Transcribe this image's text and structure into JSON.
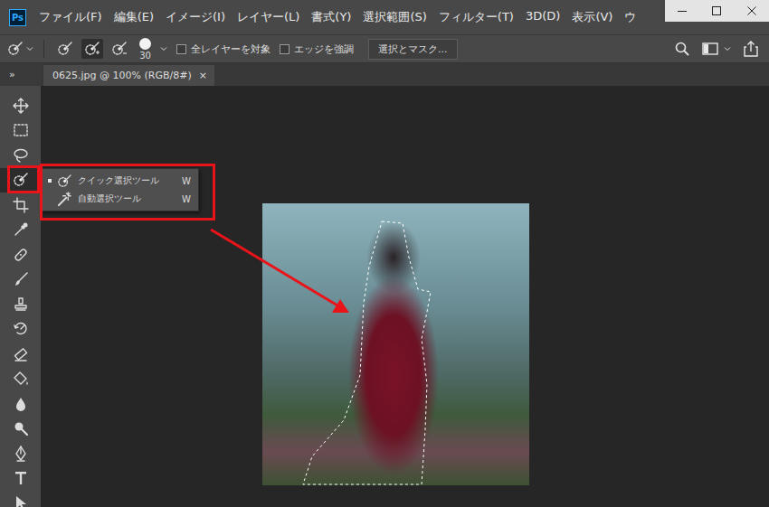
{
  "app": {
    "logo": "Ps"
  },
  "menu_bar": [
    "ファイル(F)",
    "編集(E)",
    "イメージ(I)",
    "レイヤー(L)",
    "書式(Y)",
    "選択範囲(S)",
    "フィルター(T)",
    "3D(D)",
    "表示(V)",
    "ウ"
  ],
  "options_bar": {
    "selection_modes": [
      {
        "selected": false
      },
      {
        "selected": true
      },
      {
        "selected": false
      }
    ],
    "brush_size": "30",
    "checkboxes": [
      {
        "label": "全レイヤーを対象",
        "checked": false
      },
      {
        "label": "エッジを強調",
        "checked": false
      }
    ],
    "button": "選択とマスク..."
  },
  "panel_toggle": "»",
  "document_tabs": [
    {
      "label": "0625.jpg @ 100% (RGB/8#)",
      "close": "×",
      "selected": true
    }
  ],
  "tools": [
    {
      "kind": "move",
      "selected": false
    },
    {
      "kind": "marquee",
      "selected": false
    },
    {
      "kind": "lasso",
      "selected": false
    },
    {
      "kind": "quickselect",
      "selected": true
    },
    {
      "kind": "crop",
      "selected": false
    },
    {
      "kind": "eyedropper",
      "selected": false
    },
    {
      "kind": "healing",
      "selected": false
    },
    {
      "kind": "brush",
      "selected": false
    },
    {
      "kind": "stamp",
      "selected": false
    },
    {
      "kind": "historybrush",
      "selected": false
    },
    {
      "kind": "eraser",
      "selected": false
    },
    {
      "kind": "bucket",
      "selected": false
    },
    {
      "kind": "blur",
      "selected": false
    },
    {
      "kind": "dodge",
      "selected": false
    },
    {
      "kind": "pen",
      "selected": false
    },
    {
      "kind": "type",
      "selected": false
    },
    {
      "kind": "pathselect",
      "selected": false
    }
  ],
  "flyout": {
    "items": [
      {
        "label": "クイック選択ツール",
        "shortcut": "W",
        "selected": true,
        "kind": "quickselect"
      },
      {
        "label": "自動選択ツール",
        "shortcut": "W",
        "selected": false,
        "kind": "magicwand"
      }
    ]
  }
}
